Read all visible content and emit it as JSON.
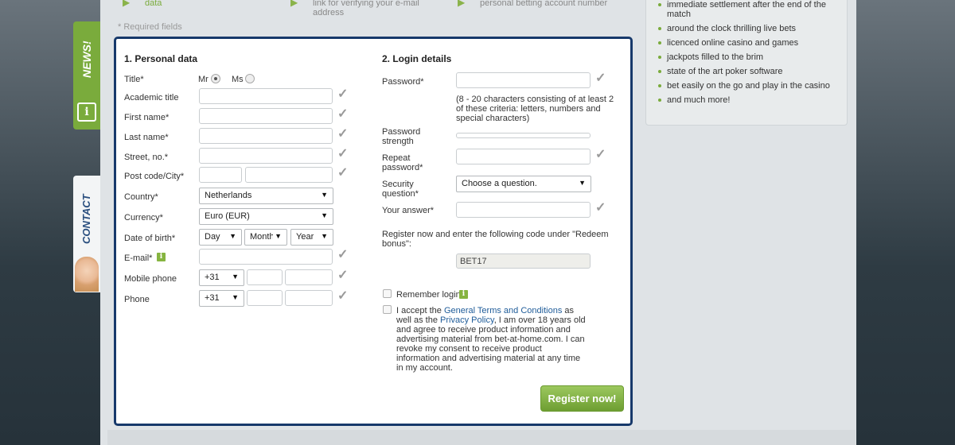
{
  "steps": {
    "step1": "data",
    "step2_line1": "link for verifying your e-mail",
    "step2_line2": "address",
    "step3": "personal betting account number"
  },
  "required_note": "* Required fields",
  "tabs": {
    "news": "NEWS!",
    "info": "i",
    "contact": "CONTACT"
  },
  "personal": {
    "title": "1. Personal data",
    "title_label": "Title*",
    "mr": "Mr",
    "ms": "Ms",
    "academic_title": "Academic title",
    "first_name": "First name*",
    "last_name": "Last name*",
    "street": "Street, no.*",
    "postcode_city": "Post code/City*",
    "country": "Country*",
    "country_value": "Netherlands",
    "currency": "Currency*",
    "currency_value": "Euro (EUR)",
    "dob": "Date of birth*",
    "day": "Day",
    "month": "Month",
    "year": "Year",
    "email": "E-mail*",
    "mobile": "Mobile phone",
    "mobile_prefix": "+31",
    "phone": "Phone",
    "phone_prefix": "+31"
  },
  "login": {
    "title": "2. Login details",
    "password": "Password*",
    "password_hint": "(8 - 20 characters consisting of at least 2 of these criteria: letters, numbers and special characters)",
    "strength_line1": "Password",
    "strength_line2": "strength",
    "repeat_line1": "Repeat",
    "repeat_line2": "password*",
    "security_line1": "Security",
    "security_line2": "question*",
    "security_value": "Choose a question.",
    "answer": "Your answer*",
    "bonus_text": "Register now and enter the following code under \"Redeem bonus\":",
    "bonus_code": "BET17",
    "remember": "Remember login",
    "accept_pre": "I accept the ",
    "terms_link": "General Terms and Conditions",
    "accept_mid": " as well as the ",
    "privacy_link": "Privacy Policy",
    "accept_post": ", I am over 18 years old and agree to receive product information and advertising material from bet-at-home.com. I can revoke my consent to receive product information and advertising material at any time in my account.",
    "register": "Register now!"
  },
  "benefits": [
    "immediate settlement after the end of the match",
    "around the clock thrilling live bets",
    "licenced online casino and games",
    "jackpots filled to the brim",
    "state of the art poker software",
    "bet easily on the go and play in the casino",
    "and much more!"
  ],
  "colors": {
    "accent_green": "#7aab3c",
    "form_border": "#17396b",
    "link": "#1f5c99"
  }
}
